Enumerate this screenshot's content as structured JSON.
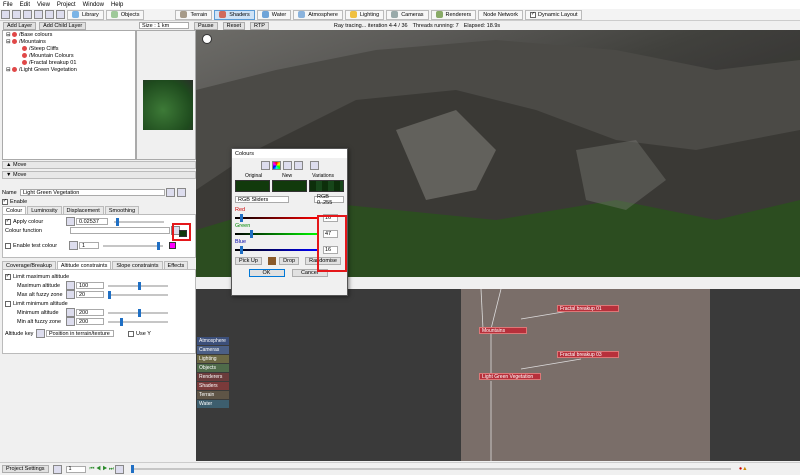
{
  "menu": [
    "File",
    "Edit",
    "View",
    "Project",
    "Window",
    "Help"
  ],
  "toolbar": {
    "tabs": [
      {
        "label": "Library",
        "color": "#7bb4e6"
      },
      {
        "label": "Objects",
        "color": "#9fc99a"
      },
      {
        "label": "Terrain",
        "color": "#a69a88"
      },
      {
        "label": "Shaders",
        "color": "#d06a5e"
      },
      {
        "label": "Water",
        "color": "#6fa4d8"
      },
      {
        "label": "Atmosphere",
        "color": "#8ab3dd"
      },
      {
        "label": "Lighting",
        "color": "#f0c040"
      },
      {
        "label": "Cameras",
        "color": "#9aa"
      },
      {
        "label": "Renderers",
        "color": "#8a6"
      },
      {
        "label": "Node Network",
        "color": "#aaa"
      }
    ],
    "dynamic_layout": "Dynamic Layout"
  },
  "layers": {
    "add_layer": "Add Layer",
    "add_child_layer": "Add Child Layer",
    "items": [
      {
        "label": "/Base colours",
        "indent": 0
      },
      {
        "label": "/Mountains",
        "indent": 0
      },
      {
        "label": "/Steep Cliffs",
        "indent": 1
      },
      {
        "label": "/Mountain Colours",
        "indent": 1
      },
      {
        "label": "/Fractal breakup 01",
        "indent": 1
      },
      {
        "label": "/Light Green Vegetation",
        "indent": 0
      }
    ],
    "move_up": "Move",
    "move_down": "Move"
  },
  "render_bar": {
    "size": "Size : 1 km",
    "pause": "Pause",
    "reset": "Reset",
    "rtp": "RTP",
    "status": "Ray tracing... iteration 4-4 / 36",
    "threads": "Threads running: 7",
    "elapsed": "Elapsed: 18.9s"
  },
  "props": {
    "name_label": "Name",
    "name_value": "Light Green Vegetation",
    "enable": "Enable",
    "tabs": [
      "Colour",
      "Luminosity",
      "Displacement",
      "Smoothing"
    ],
    "apply_colour": "Apply colour",
    "apply_value": "0.02537",
    "colour_function": "Colour function",
    "enable_test_colour": "Enable test colour",
    "test_value": "1",
    "subtabs": [
      "Coverage/Breakup",
      "Altitude constraints",
      "Slope constraints",
      "Effects"
    ],
    "limit_max": "Limit maximum altitude",
    "max_alt": "Maximum altitude",
    "max_alt_value": "100",
    "max_fuzzy": "Max alt fuzzy zone",
    "max_fuzzy_value": "20",
    "limit_min": "Limit minimum altitude",
    "min_alt": "Minimum altitude",
    "min_alt_value": "200",
    "min_fuzzy": "Min alt fuzzy zone",
    "min_fuzzy_value": "200",
    "alt_key": "Altitude key",
    "alt_key_value": "Position in terrain/texture",
    "use_y": "Use Y"
  },
  "colours_dialog": {
    "title": "Colours",
    "original": "Original",
    "new": "New",
    "variations": "Variations",
    "mode": "RGB Sliders",
    "range": "RGB 0..255",
    "red": "Red",
    "red_value": "16",
    "red_level": 0.063,
    "green": "Green",
    "green_value": "47",
    "green_level": 0.184,
    "blue": "Blue",
    "blue_value": "16",
    "blue_level": 0.063,
    "pick_up": "Pick Up",
    "drop": "Drop",
    "randomise": "Randomise",
    "ok": "OK",
    "cancel": "Cancel",
    "swatch_color": "#102f10"
  },
  "nodes": {
    "mountains": "Mountains",
    "fractal1": "Fractal breakup 01",
    "fractal3": "Fractal breakup 03",
    "lgv": "Light Green Vegetation"
  },
  "legend": [
    {
      "label": "Atmosphere",
      "color": "#3c4f7a"
    },
    {
      "label": "Cameras",
      "color": "#4b5f86"
    },
    {
      "label": "Lighting",
      "color": "#6b6844"
    },
    {
      "label": "Objects",
      "color": "#4f6b4a"
    },
    {
      "label": "Renderers",
      "color": "#6b3b3b"
    },
    {
      "label": "Shaders",
      "color": "#7a3a3a"
    },
    {
      "label": "Terrain",
      "color": "#5e5446"
    },
    {
      "label": "Water",
      "color": "#3d5e6e"
    }
  ],
  "status": {
    "project_settings": "Project Settings",
    "frame": "1"
  }
}
